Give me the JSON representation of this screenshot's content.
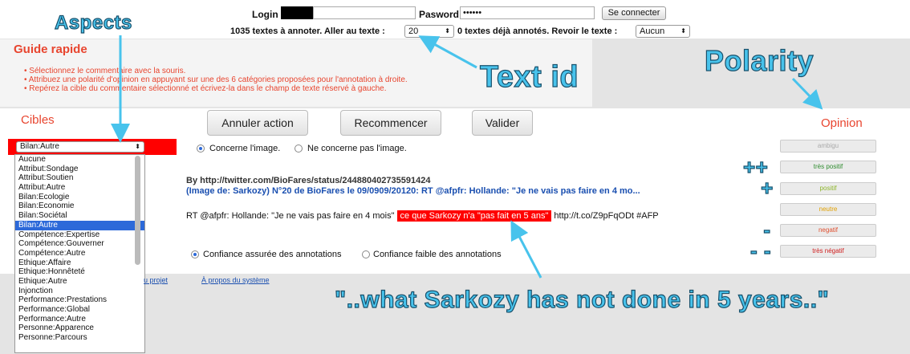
{
  "login": {
    "label": "Login",
    "value": "",
    "password_label": "Pasword",
    "password_value": "••••••",
    "connect_button": "Se connecter"
  },
  "status": {
    "count_text": "1035 textes à annoter. Aller au texte :",
    "text_select": "20",
    "annotated_text": "0 textes déjà annotés. Revoir le texte :",
    "review_select": "Aucun"
  },
  "guide": {
    "title": "Guide rapide",
    "items": [
      "Sélectionnez le commentaire avec la souris.",
      "Attribuez une polarité d'opinion en appuyant sur une des 6 catégories proposées pour l'annotation à droite.",
      "Repérez la cible du commentaire sélectionné et écrivez-la dans le champ de texte réservé à gauche."
    ]
  },
  "cibles": {
    "title": "Cibles",
    "selected": "Bilan:Autre",
    "options": [
      "Aucune",
      "Attribut:Sondage",
      "Attribut:Soutien",
      "Attribut:Autre",
      "Bilan:Ecologie",
      "Bilan:Economie",
      "Bilan:Sociétal",
      "Bilan:Autre",
      "Compétence:Expertise",
      "Compétence:Gouverner",
      "Compétence:Autre",
      "Ethique:Affaire",
      "Ethique:Honnêteté",
      "Ethique:Autre",
      "Injonction",
      "Performance:Prestations",
      "Performance:Global",
      "Performance:Autre",
      "Personne:Apparence",
      "Personne:Parcours"
    ]
  },
  "actions": {
    "undo": "Annuler action",
    "restart": "Recommencer",
    "validate": "Valider"
  },
  "image": {
    "concerne": "Concerne l'image.",
    "ne_concerne": "Ne concerne pas l'image."
  },
  "tweet": {
    "by": "By http://twitter.com/BioFares/status/244880402735591424",
    "image_line": "(Image de: Sarkozy) N°20 de BioFares le 09/0909/20120: RT @afpfr: Hollande: \"Je ne vais pas faire en 4 mo...",
    "text_before": "RT @afpfr: Hollande: \"Je ne vais pas faire en 4 mois\"",
    "text_highlight": "ce que Sarkozy n'a \"pas fait en 5 ans\"",
    "text_after": "http://t.co/Z9pFqODt #AFP"
  },
  "confidence": {
    "high": "Confiance assurée des annotations",
    "low": "Confiance faible des annotations"
  },
  "footer": {
    "link1": "u projet",
    "link2": "À propos du système"
  },
  "opinion": {
    "title": "Opinion",
    "buttons": [
      {
        "label": "ambigu",
        "color": "#aaaaaa"
      },
      {
        "label": "très positif",
        "color": "#2e8b2e"
      },
      {
        "label": "positif",
        "color": "#8db52a"
      },
      {
        "label": "neutre",
        "color": "#e0a000"
      },
      {
        "label": "negatif",
        "color": "#e05030"
      },
      {
        "label": "très négatif",
        "color": "#d02020"
      }
    ],
    "symbols": [
      "++",
      "+",
      "",
      "-",
      "- -"
    ]
  },
  "annotations": {
    "aspects": "Aspects",
    "text_id": "Text id",
    "polarity": "Polarity",
    "quote": "\"..what Sarkozy has not done in 5 years..\""
  },
  "colors": {
    "accent": "#e8452f",
    "annotation": "#48c3ec",
    "highlight": "#ff0000",
    "link": "#1a4fb0"
  }
}
